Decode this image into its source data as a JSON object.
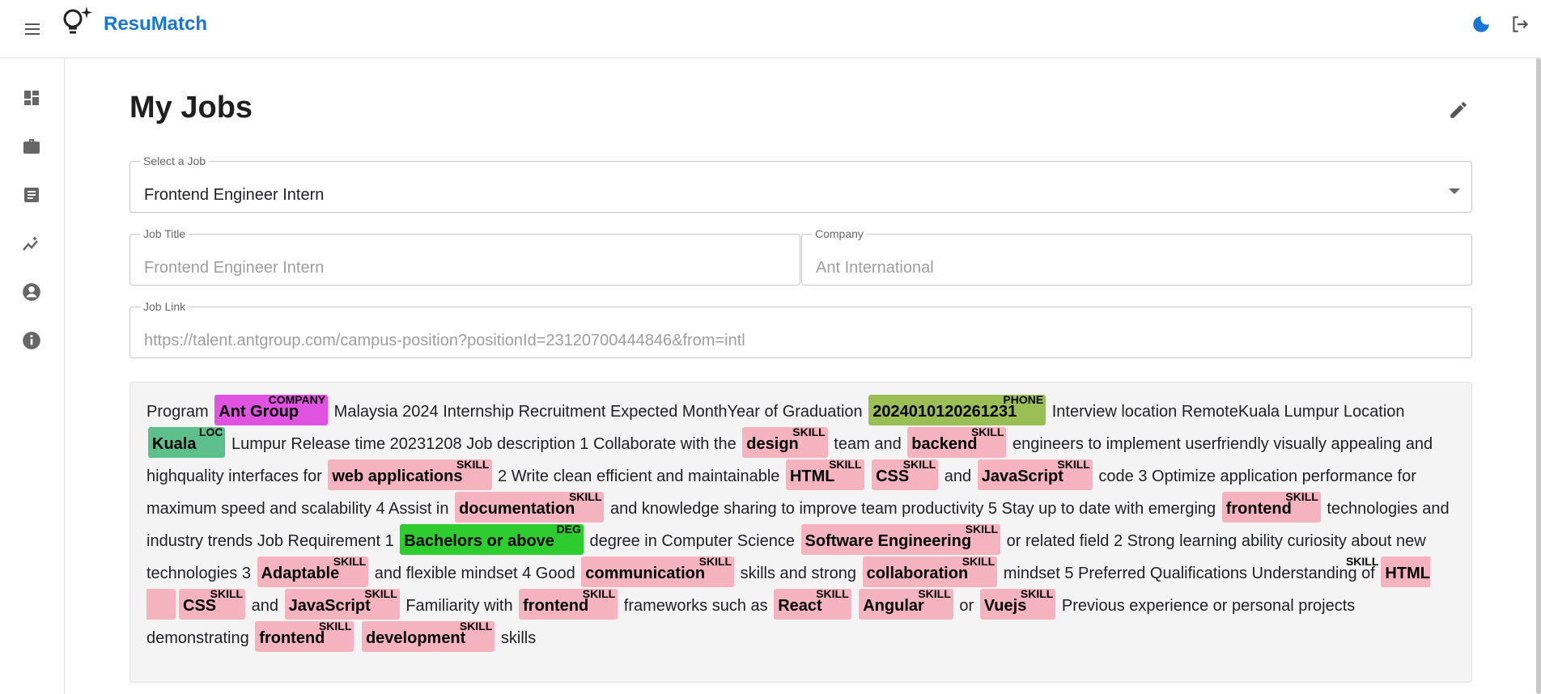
{
  "app": {
    "brand": "ResuMatch",
    "accent": "#1976d2"
  },
  "header": {
    "menu_icon": "menu-icon",
    "logo_icon": "lightbulb-icon",
    "theme_icon": "moon-icon",
    "logout_icon": "logout-icon"
  },
  "sidebar": {
    "items": [
      {
        "icon": "dashboard-icon"
      },
      {
        "icon": "briefcase-icon"
      },
      {
        "icon": "document-icon"
      },
      {
        "icon": "analytics-icon"
      },
      {
        "icon": "account-icon"
      },
      {
        "icon": "info-icon"
      }
    ]
  },
  "page": {
    "title": "My Jobs",
    "edit_icon": "pencil-icon"
  },
  "form": {
    "select_job": {
      "label": "Select a Job",
      "value": "Frontend Engineer Intern"
    },
    "job_title": {
      "label": "Job Title",
      "value": "Frontend Engineer Intern"
    },
    "company": {
      "label": "Company",
      "value": "Ant International"
    },
    "job_link": {
      "label": "Job Link",
      "value": "https://talent.antgroup.com/campus-position?positionId=23120700444846&from=intl"
    }
  },
  "entity_colors": {
    "SKILL": "#f5b3bf",
    "COMPANY": "#e052e0",
    "PHONE": "#9bbf55",
    "LOC": "#5cbf8c",
    "DEG": "#2ecc2e"
  },
  "description": [
    {
      "t": "Program "
    },
    {
      "e": "Ant Group",
      "tag": "COMPANY"
    },
    {
      "t": " Malaysia 2024 Internship Recruitment Expected MonthYear of Graduation "
    },
    {
      "e": "2024010120261231",
      "tag": "PHONE"
    },
    {
      "t": " Interview location RemoteKuala Lumpur Location "
    },
    {
      "e": "Kuala",
      "tag": "LOC"
    },
    {
      "t": " Lumpur Release time 20231208 Job description 1 Collaborate with the "
    },
    {
      "e": "design",
      "tag": "SKILL"
    },
    {
      "t": " team and "
    },
    {
      "e": "backend",
      "tag": "SKILL"
    },
    {
      "t": " engineers to implement userfriendly visually appealing and highquality interfaces for "
    },
    {
      "e": "web applications",
      "tag": "SKILL"
    },
    {
      "t": " 2 Write clean efficient and maintainable "
    },
    {
      "e": "HTML",
      "tag": "SKILL"
    },
    {
      "t": " "
    },
    {
      "e": "CSS",
      "tag": "SKILL"
    },
    {
      "t": " and "
    },
    {
      "e": "JavaScript",
      "tag": "SKILL"
    },
    {
      "t": " code 3 Optimize application performance for maximum speed and scalability 4 Assist in "
    },
    {
      "e": "documentation",
      "tag": "SKILL"
    },
    {
      "t": " and knowledge sharing to improve team productivity 5 Stay up to date with emerging "
    },
    {
      "e": "frontend",
      "tag": "SKILL"
    },
    {
      "t": " technologies and industry trends Job Requirement 1 "
    },
    {
      "e": "Bachelors or above",
      "tag": "DEG"
    },
    {
      "t": " degree in Computer Science "
    },
    {
      "e": "Software Engineering",
      "tag": "SKILL"
    },
    {
      "t": " or related field 2 Strong learning ability curiosity about new technologies 3 "
    },
    {
      "e": "Adaptable",
      "tag": "SKILL"
    },
    {
      "t": " and flexible mindset 4 Good "
    },
    {
      "e": "communication",
      "tag": "SKILL"
    },
    {
      "t": " skills and strong "
    },
    {
      "e": "collaboration",
      "tag": "SKILL"
    },
    {
      "t": " mindset 5 Preferred Qualifications Understanding of "
    },
    {
      "e": "HTML",
      "tag": "SKILL"
    },
    {
      "t": " "
    },
    {
      "e": "CSS",
      "tag": "SKILL"
    },
    {
      "t": " and "
    },
    {
      "e": "JavaScript",
      "tag": "SKILL"
    },
    {
      "t": " Familiarity with "
    },
    {
      "e": "frontend",
      "tag": "SKILL"
    },
    {
      "t": " frameworks such as "
    },
    {
      "e": "React",
      "tag": "SKILL"
    },
    {
      "t": " "
    },
    {
      "e": "Angular",
      "tag": "SKILL"
    },
    {
      "t": " or "
    },
    {
      "e": "Vuejs",
      "tag": "SKILL"
    },
    {
      "t": " Previous experience or personal projects demonstrating "
    },
    {
      "e": "frontend",
      "tag": "SKILL"
    },
    {
      "t": " "
    },
    {
      "e": "development",
      "tag": "SKILL"
    },
    {
      "t": " skills"
    }
  ]
}
